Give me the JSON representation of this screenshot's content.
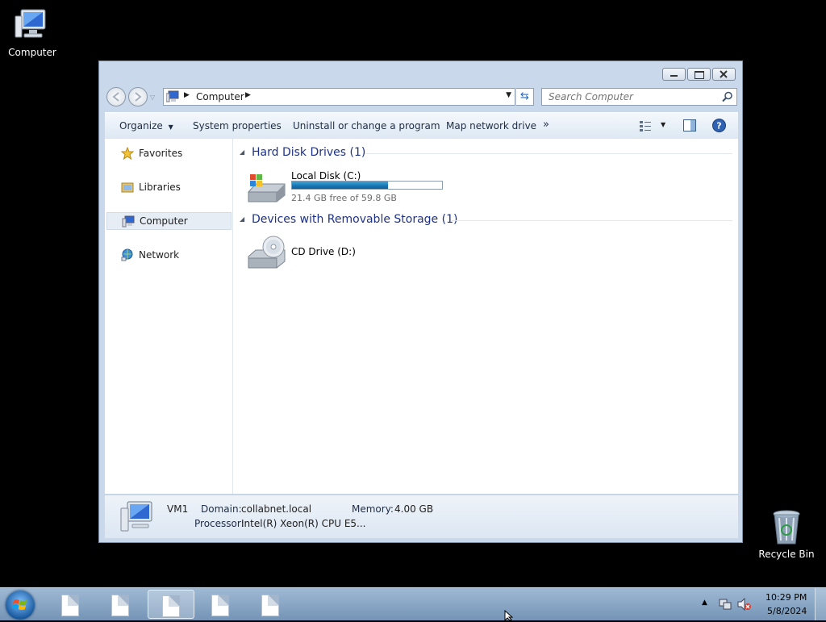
{
  "desktop": {
    "icons": [
      {
        "label": "Computer",
        "icon": "computer-icon"
      },
      {
        "label": "Recycle Bin",
        "icon": "recycle-bin-icon"
      }
    ]
  },
  "window": {
    "address": {
      "crumbs": [
        "Computer"
      ]
    },
    "search": {
      "placeholder": "Search Computer"
    },
    "toolbar": {
      "organize": "Organize",
      "system_properties": "System properties",
      "uninstall": "Uninstall or change a program",
      "map_drive": "Map network drive",
      "more": "»"
    },
    "nav": [
      {
        "label": "Favorites",
        "icon": "star-icon"
      },
      {
        "label": "Libraries",
        "icon": "libraries-icon"
      },
      {
        "label": "Computer",
        "icon": "computer-icon",
        "selected": true
      },
      {
        "label": "Network",
        "icon": "network-icon"
      }
    ],
    "groups": [
      {
        "title": "Hard Disk Drives (1)",
        "items": [
          {
            "name": "Local Disk (C:)",
            "free_text": "21.4 GB free of 59.8 GB",
            "used_fraction": 0.642
          }
        ]
      },
      {
        "title": "Devices with Removable Storage (1)",
        "items": [
          {
            "name": "CD Drive (D:)"
          }
        ]
      }
    ],
    "details": {
      "name": "VM1",
      "domain_label": "Domain:",
      "domain": "collabnet.local",
      "memory_label": "Memory:",
      "memory": "4.00 GB",
      "processor_label": "Processor:",
      "processor": "Intel(R) Xeon(R) CPU E5..."
    }
  },
  "taskbar": {
    "time": "10:29 PM",
    "date": "5/8/2024"
  }
}
